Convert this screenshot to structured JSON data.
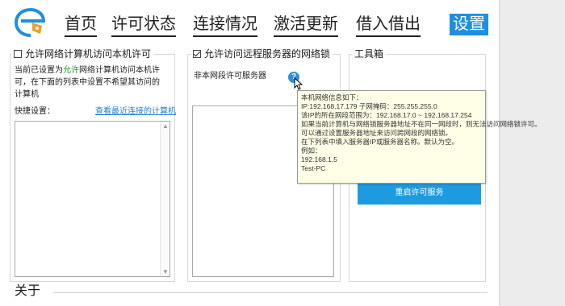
{
  "nav": {
    "home": "首页",
    "license_status": "许可状态",
    "connection": "连接情况",
    "activation_update": "激活更新",
    "borrow": "借入借出",
    "settings": "设置"
  },
  "allow_panel": {
    "title": "允许网络计算机访问本机许可",
    "desc_pre": "当前已设置为",
    "desc_allow": "允许",
    "desc_post1": "网络计算机访问本机许",
    "desc_line2": "可，在下面的列表中设置不希望其访问的",
    "desc_line3": "计算机",
    "quick_label": "快捷设置：",
    "recent_link": "查看最近连接的计算机"
  },
  "remote_panel": {
    "title": "允许访问远程服务器的网络锁",
    "nonlocal_label": "非本网段许可服务器",
    "help_glyph": "?"
  },
  "tools_panel": {
    "title": "工具箱",
    "restart_button": "重启许可服务"
  },
  "tooltip": {
    "lines": [
      "本机网络信息如下：",
      "IP:192.168.17.179    子网掩码：255.255.255.0",
      "该IP的所在网段范围为：192.168.17.0 ~ 192.168.17.254",
      "如果当前计算机与网络锁服务器地址不在同一网段时，则无法访问网络锁许可。",
      "可以通过设置服务器地址来访问跨网段的网络锁。",
      "在下列表中填入服务器IP或服务器名称。默认为空。",
      "例如：",
      "192.168.1.5",
      "Test-PC"
    ]
  },
  "about": {
    "title": "关于"
  },
  "colors": {
    "accent": "#1e90e0",
    "allow_green": "#1aa01a",
    "tooltip_bg": "#ffffe8"
  }
}
